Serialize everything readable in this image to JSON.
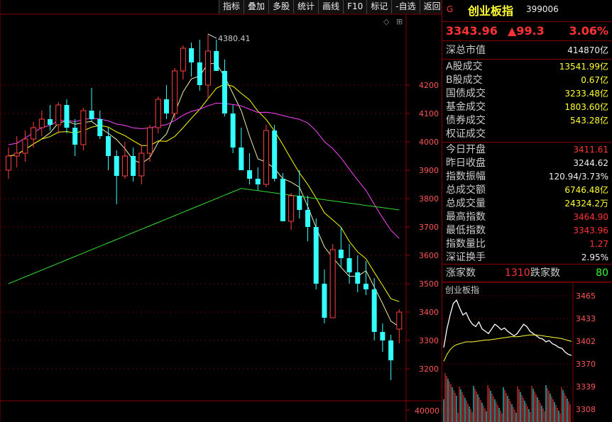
{
  "toolbar": {
    "buttons": [
      "指标",
      "叠加",
      "多股",
      "统计",
      "画线",
      "F10",
      "标记",
      "-自选",
      "返回"
    ]
  },
  "main_chart": {
    "peak_label": "4380.41",
    "y_ticks": [
      "4200",
      "4100",
      "4000",
      "3900",
      "3800",
      "3700",
      "3600",
      "3500",
      "3400",
      "3300",
      "3200"
    ],
    "volume_tick": "40000",
    "candles": [
      [
        3900,
        3980,
        3870,
        3950
      ],
      [
        3950,
        4020,
        3910,
        3960
      ],
      [
        3960,
        4040,
        3930,
        4010
      ],
      [
        4010,
        4070,
        3980,
        4050
      ],
      [
        4050,
        4110,
        4020,
        4080
      ],
      [
        4080,
        4130,
        4040,
        4060
      ],
      [
        4060,
        4140,
        4030,
        4130
      ],
      [
        4130,
        4150,
        4030,
        4050
      ],
      [
        4050,
        4080,
        3950,
        3990
      ],
      [
        3990,
        4120,
        3970,
        4110
      ],
      [
        4110,
        4190,
        4070,
        4080
      ],
      [
        4080,
        4110,
        4010,
        4020
      ],
      [
        4020,
        4050,
        3900,
        3950
      ],
      [
        3950,
        3970,
        3780,
        3880
      ],
      [
        3880,
        4000,
        3870,
        3950
      ],
      [
        3950,
        3980,
        3860,
        3880
      ],
      [
        3880,
        3990,
        3850,
        3960
      ],
      [
        3960,
        4060,
        3930,
        4050
      ],
      [
        4050,
        4160,
        4030,
        4150
      ],
      [
        4150,
        4200,
        4080,
        4100
      ],
      [
        4100,
        4260,
        4080,
        4250
      ],
      [
        4250,
        4340,
        4220,
        4330
      ],
      [
        4330,
        4350,
        4230,
        4280
      ],
      [
        4280,
        4360,
        4180,
        4200
      ],
      [
        4200,
        4380,
        4150,
        4320
      ],
      [
        4320,
        4360,
        4250,
        4250
      ],
      [
        4250,
        4290,
        4090,
        4100
      ],
      [
        4100,
        4130,
        3960,
        3980
      ],
      [
        3980,
        4050,
        3900,
        3900
      ],
      [
        3900,
        3960,
        3850,
        3870
      ],
      [
        3870,
        3910,
        3830,
        3850
      ],
      [
        3850,
        4060,
        3840,
        4040
      ],
      [
        4040,
        4060,
        3860,
        3870
      ],
      [
        3870,
        3890,
        3720,
        3720
      ],
      [
        3720,
        3820,
        3690,
        3810
      ],
      [
        3810,
        3900,
        3730,
        3760
      ],
      [
        3760,
        3810,
        3650,
        3700
      ],
      [
        3700,
        3730,
        3480,
        3500
      ],
      [
        3500,
        3550,
        3360,
        3380
      ],
      [
        3380,
        3640,
        3380,
        3620
      ],
      [
        3620,
        3700,
        3560,
        3590
      ],
      [
        3590,
        3640,
        3500,
        3540
      ],
      [
        3540,
        3600,
        3470,
        3500
      ],
      [
        3500,
        3580,
        3460,
        3480
      ],
      [
        3480,
        3520,
        3300,
        3330
      ],
      [
        3330,
        3360,
        3260,
        3300
      ],
      [
        3300,
        3320,
        3160,
        3230
      ],
      [
        3340,
        3410,
        3290,
        3400
      ]
    ],
    "ma5_color": "#eeeeaa",
    "ma10_color": "#ffff00",
    "ma20_color": "#ff44ff",
    "ma60_color": "#33dd33"
  },
  "header": {
    "g_marker": "G",
    "index_name": "创业板指",
    "index_code": "399006",
    "price": "3343.96",
    "change": "▲99.3",
    "change_pct": "3.06%"
  },
  "market_cap": {
    "label": "深总市值",
    "value": "414870亿"
  },
  "turnover_rows": [
    {
      "label": "A股成交",
      "value": "13541.99亿"
    },
    {
      "label": "B股成交",
      "value": "0.67亿"
    },
    {
      "label": "国债成交",
      "value": "3233.48亿"
    },
    {
      "label": "基金成交",
      "value": "1803.60亿"
    },
    {
      "label": "债券成交",
      "value": "543.28亿"
    },
    {
      "label": "权证成交",
      "value": ""
    }
  ],
  "stats_rows": [
    {
      "label": "今日开盘",
      "value": "3411.61",
      "color": "red"
    },
    {
      "label": "昨日收盘",
      "value": "3244.62",
      "color": "white"
    },
    {
      "label": "指数振幅",
      "value": "120.94/3.73%",
      "color": "white"
    },
    {
      "label": "总成交额",
      "value": "6746.48亿",
      "color": "gold"
    },
    {
      "label": "总成交量",
      "value": "24324.2万",
      "color": "gold"
    },
    {
      "label": "最高指数",
      "value": "3464.90",
      "color": "red"
    },
    {
      "label": "最低指数",
      "value": "3343.96",
      "color": "red"
    },
    {
      "label": "指数量比",
      "value": "1.27",
      "color": "red"
    },
    {
      "label": "深证换手",
      "value": "2.95%",
      "color": "white"
    }
  ],
  "breadth": {
    "up_label": "涨家数",
    "up_value": "1310",
    "down_label": "跌家数",
    "down_value": "80"
  },
  "mini_chart": {
    "title": "创业板指",
    "y_ticks": [
      "3465",
      "3433",
      "3402",
      "3370",
      "3339",
      "3308",
      "3276"
    ],
    "price_series": [
      3360,
      3400,
      3430,
      3455,
      3462,
      3445,
      3430,
      3435,
      3420,
      3410,
      3405,
      3415,
      3400,
      3395,
      3390,
      3400,
      3410,
      3405,
      3398,
      3402,
      3395,
      3390,
      3385,
      3390,
      3400,
      3410,
      3405,
      3395,
      3390,
      3385,
      3380,
      3378,
      3372,
      3375,
      3368,
      3365,
      3360,
      3358,
      3350,
      3345,
      3343
    ],
    "avg_series": [
      3330,
      3345,
      3355,
      3362,
      3366,
      3368,
      3370,
      3372,
      3372,
      3372,
      3373,
      3374,
      3375,
      3376,
      3376,
      3377,
      3378,
      3379,
      3380,
      3381,
      3382,
      3383,
      3383,
      3383,
      3384,
      3385,
      3386,
      3387,
      3387,
      3387,
      3386,
      3385,
      3384,
      3383,
      3382,
      3381,
      3380,
      3379,
      3377,
      3375,
      3373
    ]
  }
}
